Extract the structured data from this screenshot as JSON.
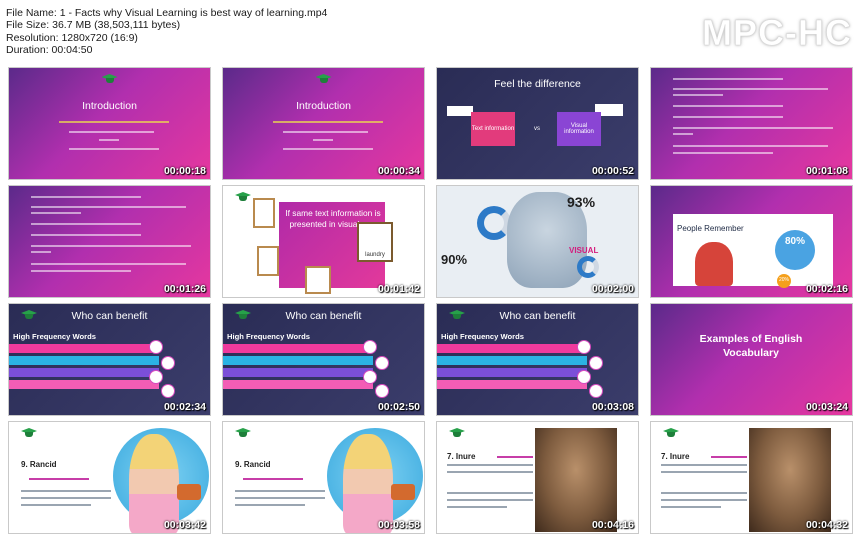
{
  "file_info": {
    "name_label": "File Name:",
    "name": "1 - Facts why Visual Learning is best way of learning.mp4",
    "size_label": "File Size:",
    "size": "36.7 MB (38,503,111 bytes)",
    "resolution_label": "Resolution:",
    "resolution": "1280x720 (16:9)",
    "duration_label": "Duration:",
    "duration": "00:04:50"
  },
  "player_logo": "MPC-HC",
  "thumbnails": [
    {
      "time": "00:00:18",
      "title": "Introduction"
    },
    {
      "time": "00:00:34",
      "title": "Introduction"
    },
    {
      "time": "00:00:52",
      "title": "Feel the difference",
      "box1": "Text information",
      "vs": "vs",
      "box2": "Visual information"
    },
    {
      "time": "00:01:08"
    },
    {
      "time": "00:01:26"
    },
    {
      "time": "00:01:42",
      "text": "If same text information is presented in visual way",
      "sign": "laundry"
    },
    {
      "time": "00:02:00",
      "pct1": "93%",
      "pct2": "90%",
      "word": "VISUAL"
    },
    {
      "time": "00:02:16",
      "title": "People Remember",
      "pct": "80%",
      "pct_small": "20%"
    },
    {
      "time": "00:02:34",
      "title": "Who can benefit",
      "heading": "High Frequency Words"
    },
    {
      "time": "00:02:50",
      "title": "Who can benefit",
      "heading": "High Frequency Words"
    },
    {
      "time": "00:03:08",
      "title": "Who can benefit",
      "heading": "High Frequency Words"
    },
    {
      "time": "00:03:24",
      "title": "Examples of English Vocabulary"
    },
    {
      "time": "00:03:42",
      "word": "9. Rancid"
    },
    {
      "time": "00:03:58",
      "word": "9. Rancid"
    },
    {
      "time": "00:04:16",
      "word": "7. Inure"
    },
    {
      "time": "00:04:32",
      "word": "7. Inure"
    }
  ],
  "colors": {
    "pink_grad_start": "#5b2a8a",
    "pink_grad_end": "#e6379f",
    "dark_bg": "#2a2c55",
    "timestamp": "#ffffff"
  }
}
